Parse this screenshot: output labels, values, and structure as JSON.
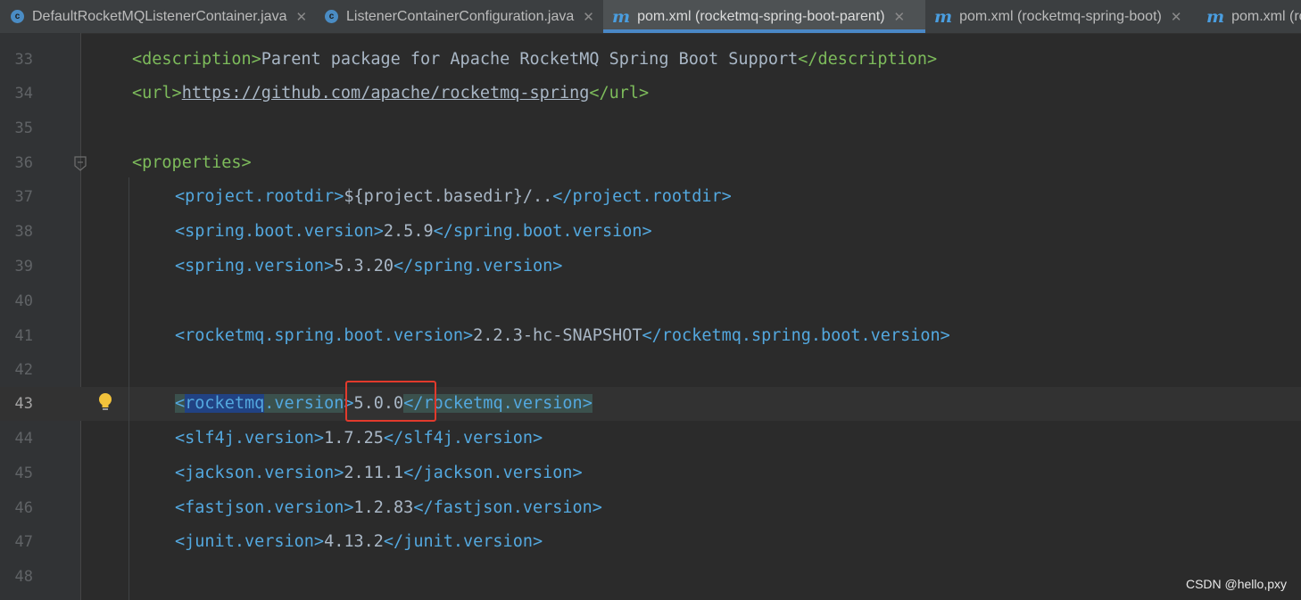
{
  "tabs": [
    {
      "label": "DefaultRocketMQListenerContainer.java",
      "icon": "java-class-icon",
      "active": false
    },
    {
      "label": "ListenerContainerConfiguration.java",
      "icon": "java-class-icon",
      "active": false
    },
    {
      "label": "pom.xml (rocketmq-spring-boot-parent)",
      "icon": "maven-icon",
      "active": true
    },
    {
      "label": "pom.xml (rocketmq-spring-boot)",
      "icon": "maven-icon",
      "active": false
    },
    {
      "label": "pom.xml (ro",
      "icon": "maven-icon",
      "active": false
    }
  ],
  "close_glyph": "✕",
  "editor": {
    "current_line": 43,
    "lines": [
      {
        "n": "33",
        "open": "<description>",
        "text": "Parent package for Apache RocketMQ Spring Boot Support",
        "close": "</description>"
      },
      {
        "n": "34",
        "open": "<url>",
        "text": "https://github.com/apache/rocketmq-spring",
        "close": "</url>"
      },
      {
        "n": "35"
      },
      {
        "n": "36",
        "open": "<properties>"
      },
      {
        "n": "37",
        "open": "<project.rootdir>",
        "text": "${project.basedir}/..",
        "close": "</project.rootdir>"
      },
      {
        "n": "38",
        "open": "<spring.boot.version>",
        "text": "2.5.9",
        "close": "</spring.boot.version>"
      },
      {
        "n": "39",
        "open": "<spring.version>",
        "text": "5.3.20",
        "close": "</spring.version>"
      },
      {
        "n": "40"
      },
      {
        "n": "41",
        "open": "<rocketmq.spring.boot.version>",
        "text": "2.2.3-hc-SNAPSHOT",
        "close": "</rocketmq.spring.boot.version>"
      },
      {
        "n": "42"
      },
      {
        "n": "43",
        "open_lt": "<",
        "open_sel": "rocketmq",
        "open_rest": ".version",
        "open_gt": ">",
        "text": "5.0.0",
        "close_lt": "<",
        "close_rest": "/rocketmq.version>"
      },
      {
        "n": "44",
        "open": "<slf4j.version>",
        "text": "1.7.25",
        "close": "</slf4j.version>"
      },
      {
        "n": "45",
        "open": "<jackson.version>",
        "text": "2.11.1",
        "close": "</jackson.version>"
      },
      {
        "n": "46",
        "open": "<fastjson.version>",
        "text": "1.2.83",
        "close": "</fastjson.version>"
      },
      {
        "n": "47",
        "open": "<junit.version>",
        "text": "4.13.2",
        "close": "</junit.version>"
      },
      {
        "n": "48"
      }
    ]
  },
  "watermark": "CSDN @hello,pxy",
  "colors": {
    "background": "#2b2b2b",
    "tag": "#53a8df",
    "outer_tag": "#7dbb5b",
    "text": "#a9b7c6",
    "highlight_box": "#e23a2c"
  }
}
